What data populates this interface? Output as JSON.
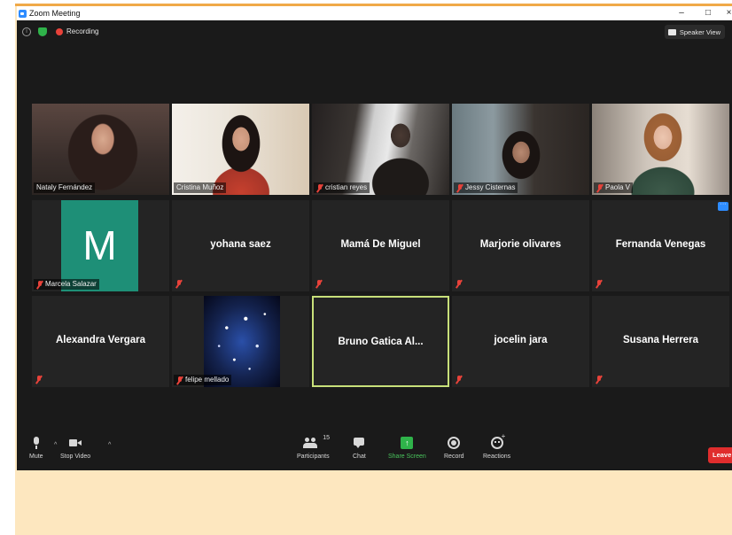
{
  "window": {
    "title": "Zoom Meeting",
    "controls": [
      "–",
      "□",
      "×"
    ]
  },
  "topbar": {
    "recording_label": "Recording",
    "speaker_view_label": "Speaker View"
  },
  "gallery": {
    "tiles": [
      {
        "kind": "video",
        "name": "Nataly Fernández",
        "muted": false
      },
      {
        "kind": "video",
        "name": "Cristina Muñoz",
        "muted": false
      },
      {
        "kind": "video",
        "name": "cristian reyes",
        "muted": true
      },
      {
        "kind": "video",
        "name": "Jessy Cisternas",
        "muted": true
      },
      {
        "kind": "video",
        "name": "Paola V",
        "muted": true
      },
      {
        "kind": "avatar",
        "avatar_letter": "M",
        "avatar_color": "#1e8f77",
        "name": "Marcela Salazar",
        "muted": true
      },
      {
        "kind": "name",
        "name": "yohana saez",
        "muted": true
      },
      {
        "kind": "name",
        "name": "Mamá De Miguel",
        "muted": true
      },
      {
        "kind": "name",
        "name": "Marjorie olivares",
        "muted": true
      },
      {
        "kind": "name",
        "name": "Fernanda Venegas",
        "muted": true
      },
      {
        "kind": "name",
        "name": "Alexandra Vergara",
        "muted": true
      },
      {
        "kind": "image",
        "name": "felipe mellado",
        "muted": true
      },
      {
        "kind": "name",
        "name": "Bruno Gatica Al...",
        "muted": false,
        "active_speaker": true
      },
      {
        "kind": "name",
        "name": "jocelin jara",
        "muted": true
      },
      {
        "kind": "name",
        "name": "Susana Herrera",
        "muted": true
      }
    ]
  },
  "toolbar": {
    "mute_label": "Mute",
    "stop_video_label": "Stop Video",
    "participants_label": "Participants",
    "participants_count": "15",
    "chat_label": "Chat",
    "share_screen_label": "Share Screen",
    "record_label": "Record",
    "reactions_label": "Reactions",
    "leave_label": "Leave"
  },
  "colors": {
    "recording": "#e8423a",
    "share": "#2fb34a",
    "leave": "#e02d2d",
    "active_speaker_border": "#c8e07a",
    "frame": "#fde7bf"
  }
}
